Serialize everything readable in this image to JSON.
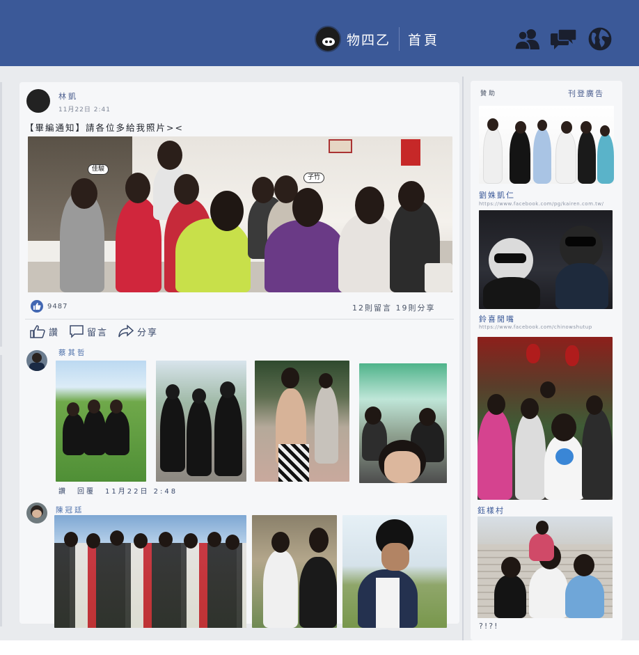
{
  "header": {
    "brand_name": "物四乙",
    "home_label": "首頁",
    "icons": [
      "friends-icon",
      "messages-icon",
      "globe-icon"
    ],
    "bar_color": "#3b5998"
  },
  "post": {
    "author": "林凱",
    "time": "11月22日 2:41",
    "text": "【畢編通知】請各位多給我照片><",
    "tags": [
      "佳駿",
      "子竹"
    ],
    "like_count": "9487",
    "stats": "12則留言 19則分享",
    "actions": {
      "like": "讚",
      "comment": "留言",
      "share": "分享"
    }
  },
  "comments": [
    {
      "name": "蔡其哲",
      "meta_like": "讚",
      "meta_reply": "回覆",
      "meta_time": "11月22日 2:48"
    },
    {
      "name": "陳冠廷"
    }
  ],
  "sidebar": {
    "left_label": "贊助",
    "create_ad": "刊登廣告",
    "ads": [
      {
        "title": "劉姝凱仁",
        "url": "https://www.facebook.com/pg/kairen.com.tw/"
      },
      {
        "title": "鈴喜閒嘴",
        "url": "https://www.facebook.com/chinowshutup"
      },
      {
        "title": "",
        "url": ""
      },
      {
        "title": "鈺樣村",
        "url": ""
      }
    ],
    "footer_text": "?!?!"
  }
}
